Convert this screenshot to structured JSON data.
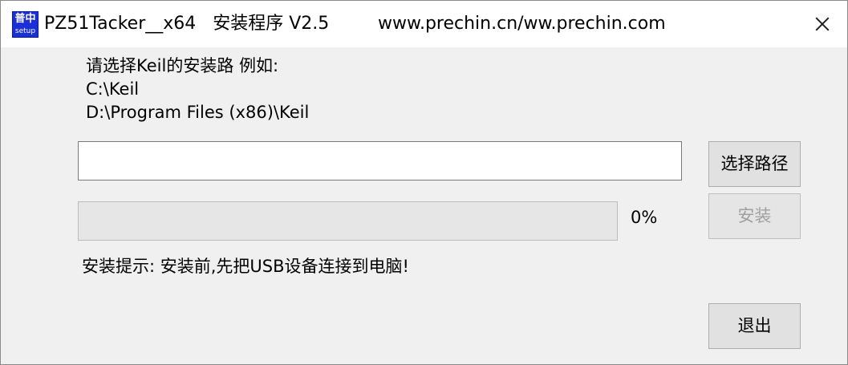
{
  "window": {
    "icon_text_top": "普中",
    "icon_text_bottom": "setup",
    "title": "PZ51Tacker__x64   安装程序 V2.5",
    "url": "www.prechin.cn/ww.prechin.com"
  },
  "instructions": {
    "line1": "请选择Keil的安装路 例如:",
    "line2": "C:\\Keil",
    "line3": "D:\\Program Files (x86)\\Keil"
  },
  "path_input": {
    "value": "",
    "placeholder": ""
  },
  "buttons": {
    "select_path": "选择路径",
    "install": "安装",
    "exit": "退出"
  },
  "progress": {
    "value": 0,
    "label": "0%"
  },
  "tip": "安装提示: 安装前,先把USB设备连接到电脑!"
}
